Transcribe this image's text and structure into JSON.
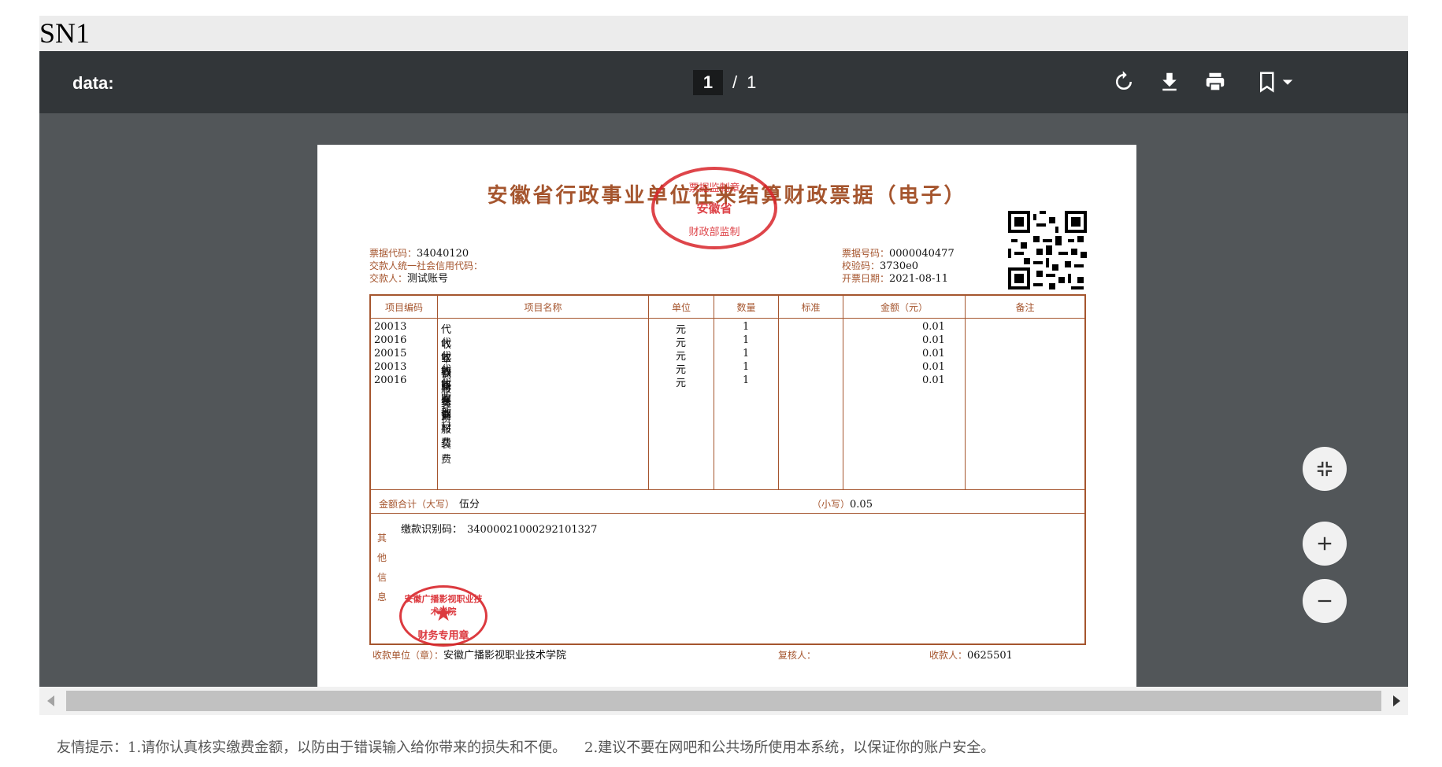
{
  "page": {
    "header_label": "SN1"
  },
  "toolbar": {
    "doc_title": "data:",
    "current_page": "1",
    "separator": "/",
    "total_pages": "1"
  },
  "icons": {
    "rotate": "rotate-icon",
    "download": "download-icon",
    "print": "print-icon",
    "bookmark": "bookmark-icon",
    "fit": "fit-page-icon",
    "zoom_in": "zoom-in-icon",
    "zoom_out": "zoom-out-icon"
  },
  "receipt": {
    "title": "安徽省行政事业单位往来结算财政票据（电子）",
    "stamp_top": {
      "line1": "票据监制章",
      "line2": "安徽省",
      "line3": "财政部监制"
    },
    "code_label": "票据代码：",
    "code_value": "34040120",
    "payer_credit_label": "交款人统一社会信用代码：",
    "payer_credit_value": "",
    "payer_label": "交款人：",
    "payer_value": "测试账号",
    "number_label": "票据号码：",
    "number_value": "0000040477",
    "check_label": "校验码：",
    "check_value": "3730e0",
    "date_label": "开票日期：",
    "date_value": "2021-08-11",
    "headers": [
      "项目编码",
      "项目名称",
      "单位",
      "数量",
      "标准",
      "金额（元）",
      "备注"
    ],
    "rows": [
      {
        "code": "20013",
        "name": "代收军训服装费",
        "unit": "元",
        "qty": "1",
        "std": "",
        "amount": "0.01",
        "note": ""
      },
      {
        "code": "20016",
        "name": "代收教材费",
        "unit": "元",
        "qty": "1",
        "std": "",
        "amount": "0.01",
        "note": ""
      },
      {
        "code": "20015",
        "name": "代收医保费",
        "unit": "元",
        "qty": "1",
        "std": "",
        "amount": "0.01",
        "note": ""
      },
      {
        "code": "20013",
        "name": "代收军训服装费",
        "unit": "元",
        "qty": "1",
        "std": "",
        "amount": "0.01",
        "note": ""
      },
      {
        "code": "20016",
        "name": "代收教材费",
        "unit": "元",
        "qty": "1",
        "std": "",
        "amount": "0.01",
        "note": ""
      }
    ],
    "total_upper_label": "金额合计（大写）",
    "total_upper_value": "伍分",
    "total_lower_label": "（小写）",
    "total_lower_value": "0.05",
    "other_info_label": "其他信息",
    "pay_id_label": "缴款识别码：",
    "pay_id_value": "34000021000292101327",
    "stamp_bottom": {
      "org": "安徽广播影视职业技术学院",
      "text": "财务专用章"
    },
    "payee_unit_label": "收款单位（章）：",
    "payee_unit_value": "安徽广播影视职业技术学院",
    "reviewer_label": "复核人：",
    "reviewer_value": "",
    "payee_label": "收款人：",
    "payee_value": "0625501"
  },
  "footer": {
    "tip": "友情提示：1.请你认真核实缴费金额，以防由于错误输入给你带来的损失和不便。    2.建议不要在网吧和公共场所使用本系统，以保证你的账户安全。"
  },
  "colors": {
    "toolbar": "#323639",
    "viewer_bg": "#525659",
    "receipt_red": "#a5552e",
    "stamp_red": "#d9252b"
  }
}
